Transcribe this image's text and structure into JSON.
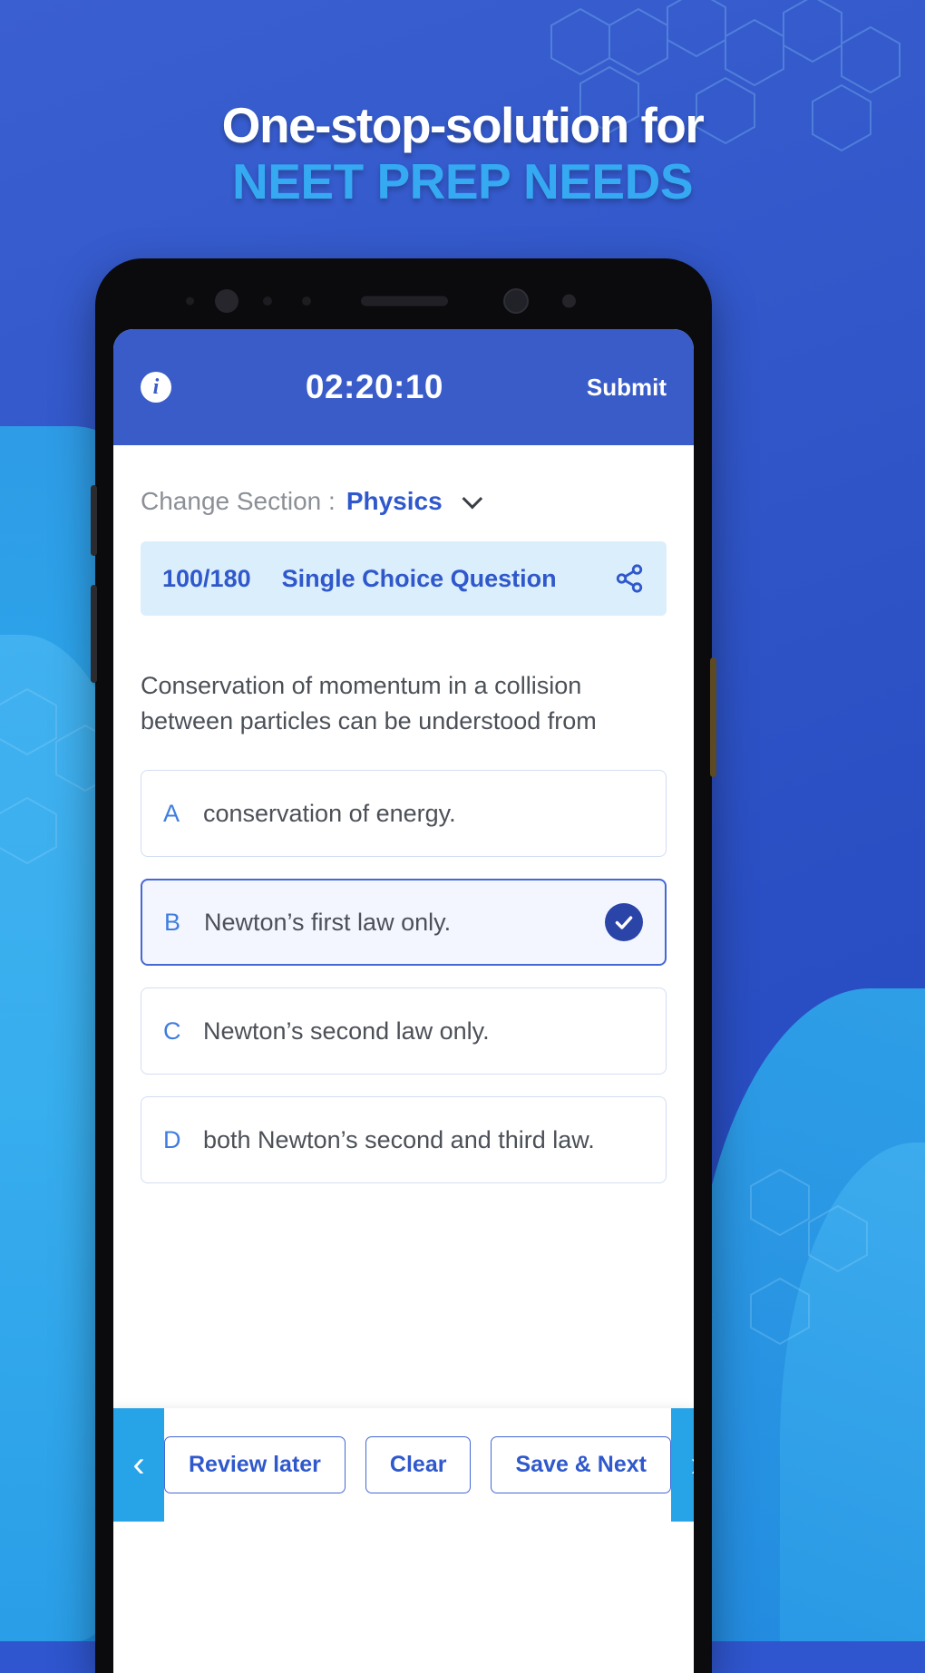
{
  "promo": {
    "headline_line1": "One-stop-solution for",
    "headline_line2": "NEET PREP NEEDS",
    "colors": {
      "bg_blue": "#3056c9",
      "accent_cyan": "#35a9f2"
    }
  },
  "app": {
    "appbar": {
      "info_icon": "info-icon",
      "timer": "02:20:10",
      "submit_label": "Submit",
      "bg_color": "#3a5cc8"
    },
    "section": {
      "label": "Change Section :",
      "value": "Physics",
      "chevron": "chevron-down-icon"
    },
    "question_banner": {
      "count": "100/180",
      "type": "Single Choice Question",
      "share_icon": "share-icon",
      "bg_color": "#dbeefc",
      "text_color": "#2f58cc"
    },
    "question": {
      "text": "Conservation of momentum in a collision between particles can be understood from",
      "options": [
        {
          "key": "A",
          "text": "conservation of energy.",
          "selected": false
        },
        {
          "key": "B",
          "text": "Newton’s first law only.",
          "selected": true
        },
        {
          "key": "C",
          "text": "Newton’s second law only.",
          "selected": false
        },
        {
          "key": "D",
          "text": "both Newton’s second and third law.",
          "selected": false
        }
      ]
    },
    "bottom_bar": {
      "prev_icon": "chevron-left-icon",
      "next_icon": "chevron-right-icon",
      "prev_glyph": "‹",
      "next_glyph": "›",
      "buttons": [
        {
          "label": "Review later"
        },
        {
          "label": "Clear"
        },
        {
          "label": "Save & Next"
        }
      ],
      "arrow_color": "#27a3e8"
    }
  }
}
